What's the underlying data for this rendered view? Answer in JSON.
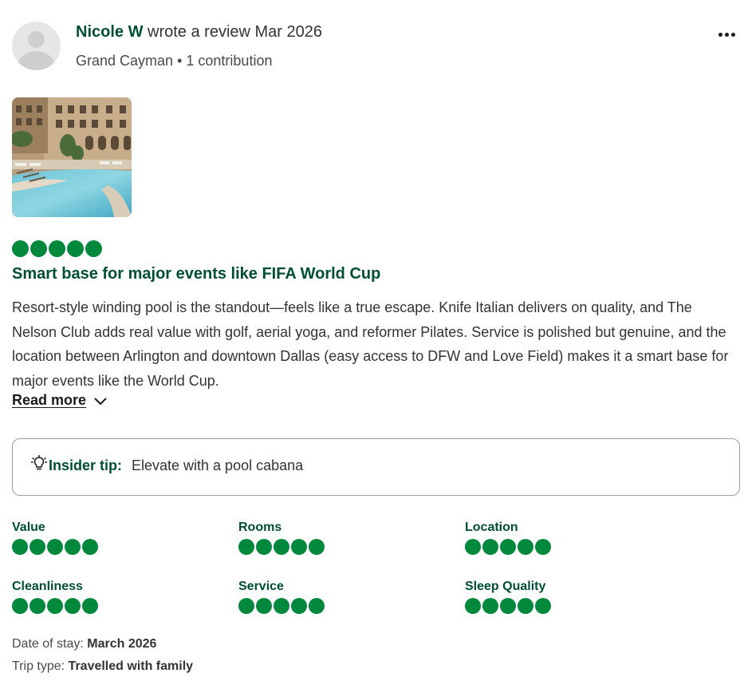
{
  "review": {
    "author": "Nicole W",
    "action": "wrote a review Mar 2026",
    "location": "Grand Cayman",
    "contributions": "1 contribution",
    "rating": 5,
    "rating_max": 5,
    "title": "Smart base for major events like FIFA World Cup",
    "body": "Resort-style winding pool is the standout—feels like a true escape. Knife Italian delivers on quality, and The Nelson Club adds real value with golf, aerial yoga, and reformer Pilates. Service is polished but genuine, and the location between Arlington and downtown Dallas (easy access to DFW and Love Field) makes it a smart base for major events like the World Cup.",
    "read_more": "Read more",
    "tip_label": "Insider tip:",
    "tip_text": "Elevate with a pool cabana",
    "subratings": [
      {
        "label": "Value",
        "rating": 5
      },
      {
        "label": "Rooms",
        "rating": 5
      },
      {
        "label": "Location",
        "rating": 5
      },
      {
        "label": "Cleanliness",
        "rating": 5
      },
      {
        "label": "Service",
        "rating": 5
      },
      {
        "label": "Sleep Quality",
        "rating": 5
      }
    ],
    "date_of_stay_label": "Date of stay:",
    "date_of_stay": "March 2026",
    "trip_type_label": "Trip type:",
    "trip_type": "Travelled with family"
  },
  "icons": {
    "more": "more-options-icon",
    "chevron": "chevron-down-icon",
    "tip": "lightbulb-icon"
  },
  "colors": {
    "bubble": "#00893d",
    "heading": "#004f32",
    "text": "#333333"
  }
}
